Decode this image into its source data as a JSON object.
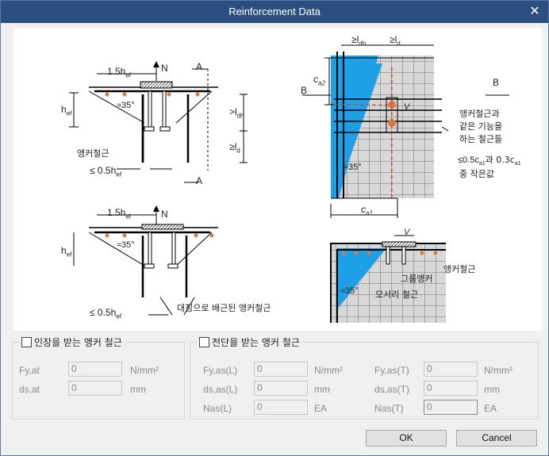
{
  "window": {
    "title": "Reinforcement Data",
    "close_glyph": "✕"
  },
  "figure": {
    "top_left": {
      "dim_1_5": "1.5h",
      "dim_1_5_sub": "ef",
      "N": "N",
      "A": "A",
      "hef": "h",
      "hef_sub": "ef",
      "angle": "≈35°",
      "ldh": ">l",
      "ldh_sub": "dh",
      "ld": "≥l",
      "ld_sub": "d",
      "anchor_rebar": "앵커철근",
      "le05": "≤ 0.5h",
      "le05_sub": "ef",
      "A_bottom": "A"
    },
    "bottom_left": {
      "dim_1_5": "1.5h",
      "dim_1_5_sub": "ef",
      "N": "N",
      "hef": "h",
      "hef_sub": "ef",
      "angle": "≈35°",
      "le05": "≤ 0.5h",
      "le05_sub": "ef",
      "symmetric": "대칭으로 배근된 앵커철근"
    },
    "top_right": {
      "ldh": "≥l",
      "ldh_sub": "dh",
      "ld": "≥l",
      "ld_sub": "d",
      "ca2": "c",
      "ca2_sub": "a2",
      "B": "B",
      "B_right": "B",
      "V": "V",
      "angle": "≈35°",
      "ca1": "c",
      "ca1_sub": "a1",
      "rebar_note1": "앵커철근과",
      "rebar_note2": "같은 기능을",
      "rebar_note3": "하는 철근들",
      "lt_note": "≤0.5c",
      "lt_note_sub": "a1",
      "lt_note_mid": "과 0.3c",
      "lt_note_sub2": "a1",
      "lt_note2": "중 작은값"
    },
    "bottom_right": {
      "V": "V",
      "anchor_rebar": "앵커철근",
      "group_anchor": "그룹앵커",
      "corner_rebar": "모서리 철근",
      "angle": "≈35°"
    }
  },
  "tension_group": {
    "title": "인장을 받는 앵커 철근",
    "fy_label": "Fy,at",
    "fy_value": "0",
    "fy_unit": "N/mm²",
    "ds_label": "ds,at",
    "ds_value": "0",
    "ds_unit": "mm"
  },
  "shear_group": {
    "title": "전단을 받는 앵커 철근",
    "fyL_label": "Fy,as(L)",
    "fyL_value": "0",
    "fyL_unit": "N/mm²",
    "dsL_label": "ds,as(L)",
    "dsL_value": "0",
    "dsL_unit": "mm",
    "nasL_label": "Nas(L)",
    "nasL_value": "0",
    "nasL_unit": "EA",
    "fyT_label": "Fy,as(T)",
    "fyT_value": "0",
    "fyT_unit": "N/mm²",
    "dsT_label": "ds,as(T)",
    "dsT_value": "0",
    "dsT_unit": "mm",
    "nasT_label": "Nas(T)",
    "nasT_value": "0",
    "nasT_unit": "EA"
  },
  "buttons": {
    "ok": "OK",
    "cancel": "Cancel"
  }
}
